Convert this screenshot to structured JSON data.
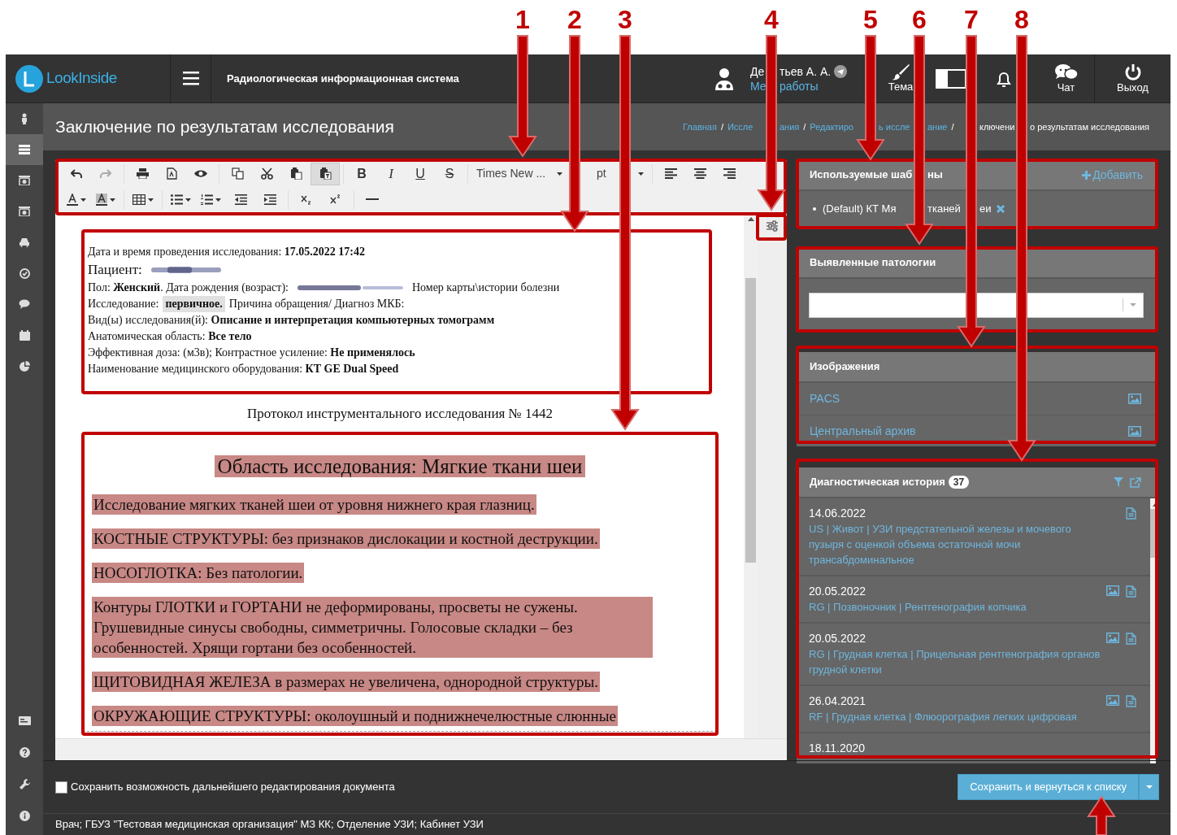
{
  "annotations": [
    {
      "label": "1"
    },
    {
      "label": "2"
    },
    {
      "label": "3"
    },
    {
      "label": "4"
    },
    {
      "label": "5"
    },
    {
      "label": "6"
    },
    {
      "label": "7"
    },
    {
      "label": "8"
    }
  ],
  "header": {
    "logo": "LookInside",
    "title": "Радиологическая информационная система",
    "user": {
      "name": [
        "Де",
        "тьев А. А."
      ],
      "menu": [
        "Ме",
        "работы"
      ]
    },
    "buttons": [
      {
        "kind": "theme",
        "label": "Тема"
      },
      {
        "kind": "toggle"
      },
      {
        "kind": "bell"
      },
      {
        "kind": "chat",
        "label": "Чат"
      },
      {
        "kind": "logout",
        "label": "Выход"
      }
    ]
  },
  "sidebar": {
    "items": [
      {
        "kind": "person",
        "selected": false
      },
      {
        "kind": "list",
        "selected": true
      },
      {
        "kind": "device",
        "selected": false
      },
      {
        "kind": "device",
        "selected": false
      },
      {
        "kind": "car",
        "selected": false
      },
      {
        "kind": "check",
        "selected": false
      },
      {
        "kind": "chat",
        "selected": false
      },
      {
        "kind": "calendar",
        "selected": false
      },
      {
        "kind": "pie",
        "selected": false
      }
    ],
    "bottom_items": [
      {
        "kind": "card"
      },
      {
        "kind": "help"
      },
      {
        "kind": "wrench"
      },
      {
        "kind": "info"
      }
    ]
  },
  "page_title": "Заключение по результатам исследования",
  "breadcrumbs": [
    {
      "parts": [
        "Главная"
      ],
      "current": false,
      "separator": "/"
    },
    {
      "parts": [
        "Иссле",
        "ания"
      ],
      "current": false,
      "separator": "/"
    },
    {
      "parts": [
        "Редактиро",
        "ь иссле",
        "ание"
      ],
      "current": false,
      "separator": "/"
    },
    {
      "parts": [
        "ключени",
        "о результатам исследования"
      ],
      "current": true,
      "leading_gap": true
    }
  ],
  "toolbar": {
    "rows": [
      [
        {
          "kind": "undo",
          "disabled": false,
          "pressed": false
        },
        {
          "kind": "redo",
          "disabled": true,
          "pressed": false
        },
        {
          "kind": "sep"
        },
        {
          "kind": "print",
          "disabled": false,
          "pressed": false
        },
        {
          "kind": "pdf",
          "disabled": false,
          "pressed": false
        },
        {
          "kind": "preview",
          "disabled": false,
          "pressed": false
        },
        {
          "kind": "sep"
        },
        {
          "kind": "copy",
          "disabled": false,
          "pressed": false
        },
        {
          "kind": "cut",
          "disabled": false,
          "pressed": false
        },
        {
          "kind": "paste",
          "disabled": false,
          "pressed": false
        },
        {
          "kind": "paste-text",
          "disabled": false,
          "pressed": true
        },
        {
          "kind": "sep"
        },
        {
          "kind": "bold",
          "label": "B",
          "disabled": false,
          "pressed": false
        },
        {
          "kind": "italic",
          "label": "I",
          "disabled": false,
          "pressed": false
        },
        {
          "kind": "underline",
          "label": "U",
          "disabled": false,
          "pressed": false
        },
        {
          "kind": "strike",
          "label": "S",
          "disabled": false,
          "pressed": false
        },
        {
          "kind": "sep"
        },
        {
          "kind": "font",
          "label": "Times New ..."
        },
        {
          "kind": "size",
          "label": "pt"
        },
        {
          "kind": "sep"
        },
        {
          "kind": "align-left",
          "disabled": false,
          "pressed": false
        },
        {
          "kind": "align-center",
          "disabled": false,
          "pressed": false
        },
        {
          "kind": "align-right",
          "disabled": false,
          "pressed": false
        }
      ],
      [
        {
          "kind": "text-color",
          "disabled": false,
          "pressed": false
        },
        {
          "kind": "bg-color",
          "disabled": false,
          "pressed": false
        },
        {
          "kind": "sep"
        },
        {
          "kind": "table",
          "disabled": false,
          "pressed": false
        },
        {
          "kind": "sep"
        },
        {
          "kind": "bullets",
          "disabled": false,
          "pressed": false
        },
        {
          "kind": "numbers",
          "disabled": false,
          "pressed": false
        },
        {
          "kind": "outdent",
          "disabled": false,
          "pressed": false
        },
        {
          "kind": "indent",
          "disabled": false,
          "pressed": false
        },
        {
          "kind": "sep"
        },
        {
          "kind": "subscript",
          "disabled": false,
          "pressed": false
        },
        {
          "kind": "superscript",
          "disabled": false,
          "pressed": false
        },
        {
          "kind": "sep"
        },
        {
          "kind": "hr",
          "disabled": false,
          "pressed": false
        }
      ]
    ]
  },
  "document": {
    "lines": [
      {
        "kind": "field",
        "parts": [
          {
            "kind": "text",
            "text": "Дата и время проведения исследования:  **17.05.2022  17:42**"
          }
        ]
      },
      {
        "kind": "patient",
        "parts": [
          {
            "kind": "text",
            "text": "Пациент:"
          },
          {
            "kind": "redacted"
          }
        ]
      },
      {
        "kind": "field",
        "parts": [
          {
            "kind": "text",
            "text": "Пол: **Женский**. Дата рождения (возраст):"
          },
          {
            "kind": "redacted"
          },
          {
            "kind": "text",
            "text": "Номер карты\\истории болезни"
          }
        ]
      },
      {
        "kind": "field",
        "parts": [
          {
            "kind": "text",
            "text": "Исследование:"
          },
          {
            "kind": "highlight",
            "text": "первичное."
          },
          {
            "kind": "text",
            "text": "Причина обращения/ Диагноз МКБ:"
          }
        ]
      },
      {
        "kind": "field",
        "parts": [
          {
            "kind": "text",
            "text": "Вид(ы) исследования(й): **Описание и интерпретация компьютерных томограмм**"
          }
        ]
      },
      {
        "kind": "field",
        "parts": [
          {
            "kind": "text",
            "text": "Анатомическая область: **Все тело**"
          }
        ]
      },
      {
        "kind": "field",
        "parts": [
          {
            "kind": "text",
            "text": "Эффективная доза:   (м3в); Контрастное усиление: **Не применялось**"
          }
        ]
      },
      {
        "kind": "field",
        "parts": [
          {
            "kind": "text",
            "text": "Наименование медицинского оборудования: **КТ GE Dual Speed**"
          }
        ]
      }
    ],
    "protocol_title": "Протокол инструментального исследования № 1442",
    "section_title": "Область исследования: Мягкие ткани шеи",
    "paragraphs": [
      "Исследование мягких тканей шеи от уровня нижнего края глазниц.",
      "КОСТНЫЕ СТРУКТУРЫ: без признаков дислокации и костной деструкции.",
      "НОСОГЛОТКА: Без патологии.",
      "Контуры ГЛОТКИ и ГОРТАНИ не деформированы, просветы не сужены. Грушевидные синусы свободны, симметричны. Голосовые складки – без особенностей. Хрящи гортани без особенностей.",
      "ЩИТОВИДНАЯ ЖЕЛЕЗА в размерах не увеличена, однородной структуры.",
      "ОКРУЖАЮЩИЕ СТРУКТУРЫ: околоушный и поднижнечелюстные слюнные"
    ]
  },
  "templates": {
    "title": [
      "Используемые шаб",
      "ны"
    ],
    "add": "Добавить",
    "items": [
      [
        "(Default) КТ Мя",
        "тканей",
        "еи"
      ]
    ]
  },
  "pathologies": {
    "title": "Выявленные патологии"
  },
  "images": {
    "title": "Изображения",
    "items": [
      "PACS",
      "Центральный архив"
    ]
  },
  "history": {
    "title": "Диагностическая история",
    "count": "37",
    "items": [
      {
        "date": "14.06.2022",
        "text": "US | Живот | УЗИ предстательной железы и мочевого пузыря с оценкой объема остаточной мочи трансабдоминальное",
        "images": false,
        "report": true
      },
      {
        "date": "20.05.2022",
        "text": "RG | Позвоночник | Рентгенография копчика",
        "images": true,
        "report": true
      },
      {
        "date": "20.05.2022",
        "text": "RG | Грудная клетка | Прицельная рентгенография органов грудной клетки",
        "images": true,
        "report": true
      },
      {
        "date": "26.04.2021",
        "text": "RF | Грудная клетка | Флюорография легких цифровая",
        "images": true,
        "report": true
      },
      {
        "date": "18.11.2020",
        "images": false,
        "report": false
      }
    ]
  },
  "footer": {
    "keep_editing": {
      "label": "Сохранить возможность дальнейшего редактирования документа",
      "checked": false
    },
    "save": "Сохранить и вернуться к списку",
    "status": "Врач; ГБУЗ \"Тестовая медицинская организация\" МЗ КК; Отделение УЗИ; Кабинет УЗИ"
  }
}
